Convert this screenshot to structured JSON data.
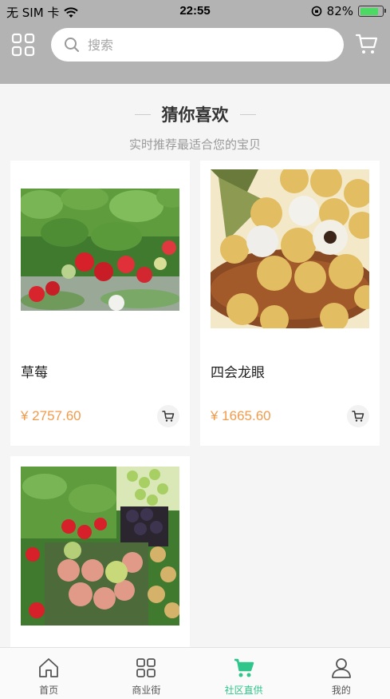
{
  "status_bar": {
    "carrier": "无 SIM 卡",
    "time": "22:55",
    "battery_percent": "82%",
    "battery_level": 0.82,
    "battery_color": "#4cd964"
  },
  "header": {
    "background": "#b3b3b3",
    "left_icon": "grid-icon",
    "search_placeholder": "搜索",
    "right_icon": "cart-icon"
  },
  "section": {
    "title": "猜你喜欢",
    "subtitle": "实时推荐最适合您的宝贝"
  },
  "products": [
    {
      "name": "草莓",
      "price": "¥ 2757.60",
      "image": "strawberry-photo"
    },
    {
      "name": "四会龙眼",
      "price": "¥ 1665.60",
      "image": "longan-photo"
    },
    {
      "name": "",
      "price": "",
      "image": "fruit-collage-photo"
    }
  ],
  "tabbar": {
    "active_color": "#2fc58b",
    "tabs": [
      {
        "label": "首页",
        "icon": "home-icon"
      },
      {
        "label": "商业街",
        "icon": "grid-icon"
      },
      {
        "label": "社区直供",
        "icon": "cart-icon",
        "active": true
      },
      {
        "label": "我的",
        "icon": "user-icon"
      }
    ]
  },
  "price_color": "#f29b4b"
}
